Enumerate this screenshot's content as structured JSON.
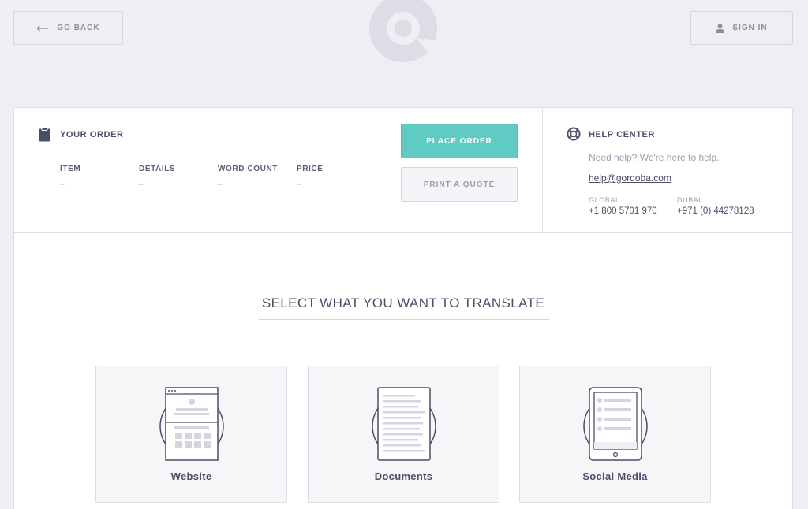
{
  "header": {
    "back_label": "GO BACK",
    "signin_label": "SIGN IN"
  },
  "order": {
    "title": "YOUR ORDER",
    "columns": [
      {
        "header": "ITEM",
        "value": "–"
      },
      {
        "header": "DETAILS",
        "value": "–"
      },
      {
        "header": "WORD COUNT",
        "value": "–"
      },
      {
        "header": "PRICE",
        "value": "–"
      }
    ],
    "place_order_label": "PLACE ORDER",
    "print_quote_label": "PRINT A QUOTE"
  },
  "help": {
    "title": "HELP CENTER",
    "text": "Need help? We're here to help.",
    "email": "help@gordoba.com",
    "phones": [
      {
        "label": "GLOBAL",
        "number": "+1 800 5701 970"
      },
      {
        "label": "DUBAI",
        "number": "+971 (0) 44278128"
      }
    ]
  },
  "select": {
    "title": "SELECT WHAT YOU WANT TO TRANSLATE",
    "options": [
      {
        "label": "Website",
        "icon": "website-icon"
      },
      {
        "label": "Documents",
        "icon": "documents-icon"
      },
      {
        "label": "Social Media",
        "icon": "social-media-icon"
      }
    ]
  },
  "colors": {
    "accent": "#5fcbc3",
    "background": "#eeeef3",
    "text": "#4a4e66",
    "muted": "#9a9db0"
  }
}
